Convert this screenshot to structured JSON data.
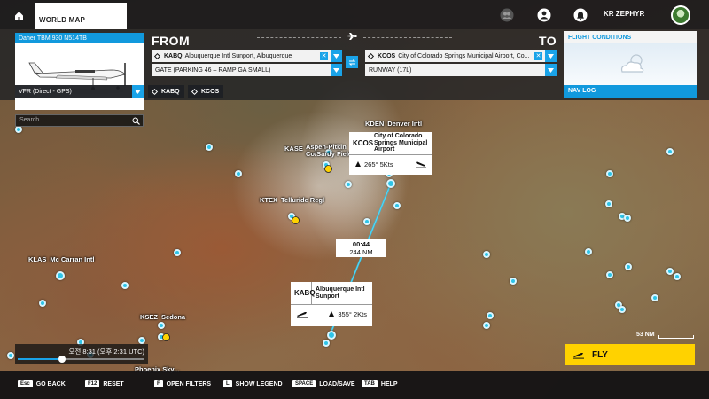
{
  "topbar": {
    "tab_label": "WORLD MAP",
    "username": "KR ZEPHYR",
    "icons": [
      "home-icon",
      "friends-icon",
      "profile-icon",
      "notifications-icon"
    ]
  },
  "aircraft": {
    "name": "Daher TBM 930 N514TB"
  },
  "from": {
    "title": "FROM",
    "airport_icao": "KABQ",
    "airport_name": "Albuquerque Intl Sunport, Albuquerque",
    "parking": "GATE (PARKING 46 – RAMP GA SMALL)"
  },
  "to": {
    "title": "TO",
    "airport_icao": "KCOS",
    "airport_name": "City of Colorado Springs Municipal Airport, Co...",
    "runway": "RUNWAY (17L)"
  },
  "conditions": {
    "title": "FLIGHT CONDITIONS"
  },
  "route": {
    "type": "VFR (Direct - GPS)",
    "waypoints": [
      "KABQ",
      "KCOS"
    ]
  },
  "navlog": {
    "label": "NAV LOG"
  },
  "search": {
    "placeholder": "Search"
  },
  "map_labels": {
    "kden_icao": "KDEN",
    "kden_name": "Denver Intl",
    "kase_icao": "KASE",
    "kase_name": "Aspen-Pitkin Co/Sardy Field",
    "ktex_icao": "KTEX",
    "ktex_name": "Telluride Regl",
    "klas_icao": "KLAS",
    "klas_name": "Mc Carran Intl",
    "ksez_icao": "KSEZ",
    "ksez_name": "Sedona",
    "phx_name": "Phoenix Sky..."
  },
  "destination_callout": {
    "icao": "KCOS",
    "name": "City of Colorado Springs Municipal Airport",
    "wind": "265° 5Kts"
  },
  "origin_callout": {
    "icao": "KABQ",
    "name": "Albuquerque Intl Sunport",
    "wind": "355° 2Kts"
  },
  "leg": {
    "time": "00:44",
    "distance": "244 NM"
  },
  "time_widget": {
    "text": "오전 8:31 (오후 2:31 UTC)",
    "progress": 0.35
  },
  "scale": {
    "label": "53 NM"
  },
  "fly_button": {
    "label": "FLY"
  },
  "footer": {
    "hints": [
      {
        "key": "Esc",
        "label": "GO BACK"
      },
      {
        "key": "F12",
        "label": "RESET"
      },
      {
        "key": "F",
        "label": "OPEN FILTERS"
      },
      {
        "key": "L",
        "label": "SHOW LEGEND"
      },
      {
        "key": "SPACE",
        "label": "LOAD/SAVE"
      },
      {
        "key": "TAB",
        "label": "HELP"
      }
    ]
  },
  "colors": {
    "accent": "#1199dd",
    "fly": "#ffd200",
    "airport": "#2ec4e8"
  }
}
